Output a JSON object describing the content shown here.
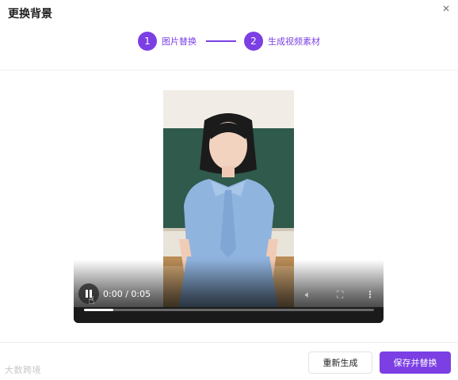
{
  "dialog": {
    "title": "更换背景",
    "close_icon": "✕"
  },
  "steps": [
    {
      "number": "1",
      "label": "图片替换"
    },
    {
      "number": "2",
      "label": "生成视频素材"
    }
  ],
  "player": {
    "time": "0:00 / 0:05",
    "progress_fraction": 0.0,
    "controls": [
      "pause-icon",
      "volume-icon",
      "fullscreen-icon",
      "more-icon"
    ]
  },
  "footer": {
    "watermark": "大数跨境",
    "regenerate_label": "重新生成",
    "save_label": "保存并替换"
  },
  "colors": {
    "accent": "#7b3fe4",
    "text": "#1f1f1f"
  }
}
